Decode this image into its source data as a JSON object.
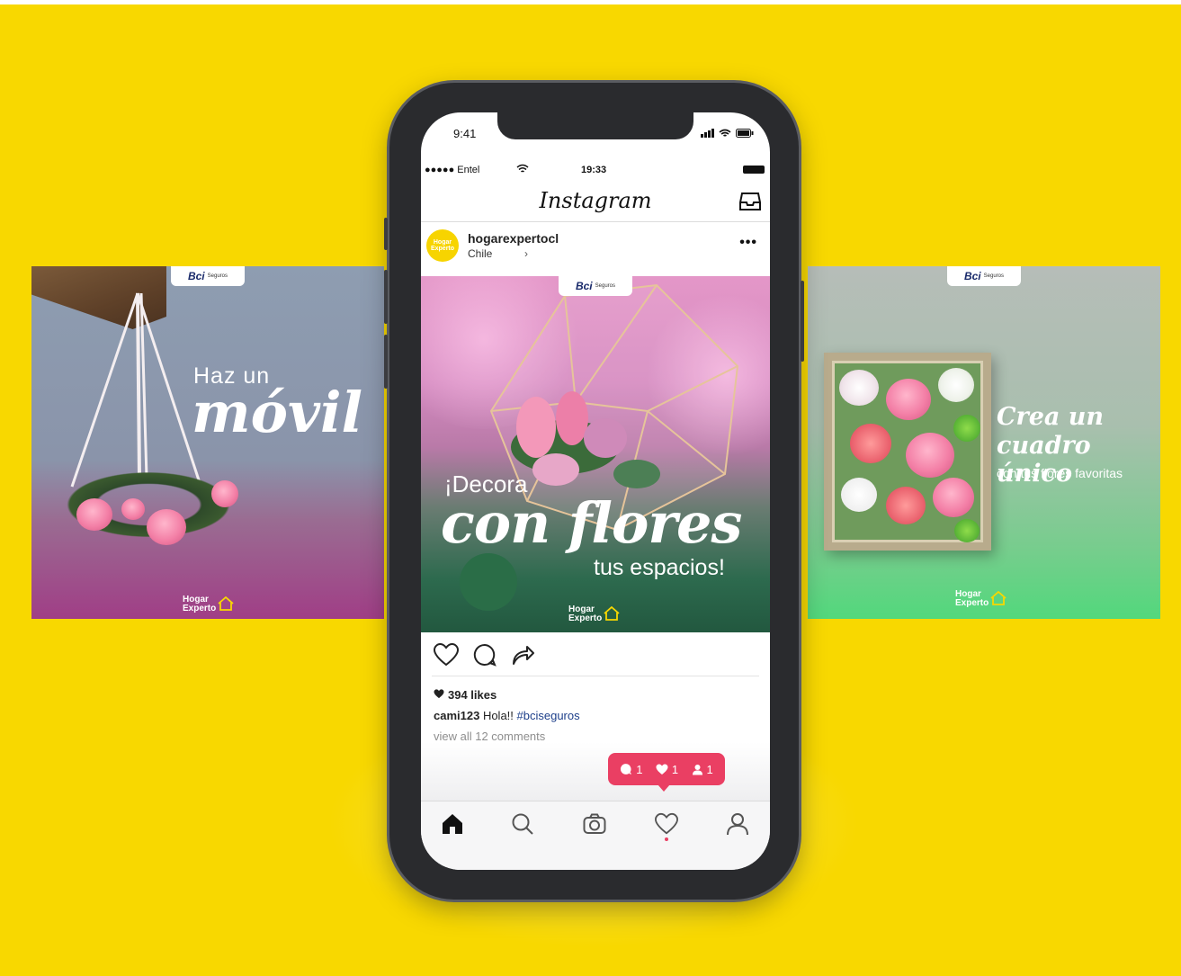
{
  "colors": {
    "background": "#f8d800",
    "notification": "#ea3f63",
    "hashtag": "#1d3f8a",
    "brand_yellow": "#f7d400"
  },
  "phone": {
    "status_time": "9:41",
    "carrier": "●●●●● Entel",
    "clock": "19:33",
    "app_title": "Instagram",
    "post": {
      "username": "hogarexpertocl",
      "location": "Chile",
      "location_arrow": "›",
      "more": "•••",
      "avatar_text": "Hogar Experto",
      "image": {
        "brand": "Bci",
        "brand_sub": "Seguros",
        "line1": "¡Decora",
        "line2": "con flores",
        "line3": "tus espacios!",
        "logo_line1": "Hogar",
        "logo_line2": "Experto"
      },
      "likes": "394 likes",
      "caption_user": "cami123",
      "caption_text": " Hola!! ",
      "caption_tag": "#bciseguros",
      "view_comments": "view all 12 comments"
    },
    "notification": {
      "comments": "1",
      "likes": "1",
      "follows": "1"
    },
    "tabs": [
      "home-icon",
      "search-icon",
      "camera-icon",
      "heart-icon",
      "profile-icon"
    ]
  },
  "left_card": {
    "brand": "Bci",
    "brand_sub": "Seguros",
    "line1": "Haz un",
    "line2": "móvil",
    "logo_line1": "Hogar",
    "logo_line2": "Experto"
  },
  "right_card": {
    "brand": "Bci",
    "brand_sub": "Seguros",
    "line1": "Crea un",
    "line2": "cuadro único",
    "line3": "con tus flores favoritas",
    "logo_line1": "Hogar",
    "logo_line2": "Experto"
  }
}
